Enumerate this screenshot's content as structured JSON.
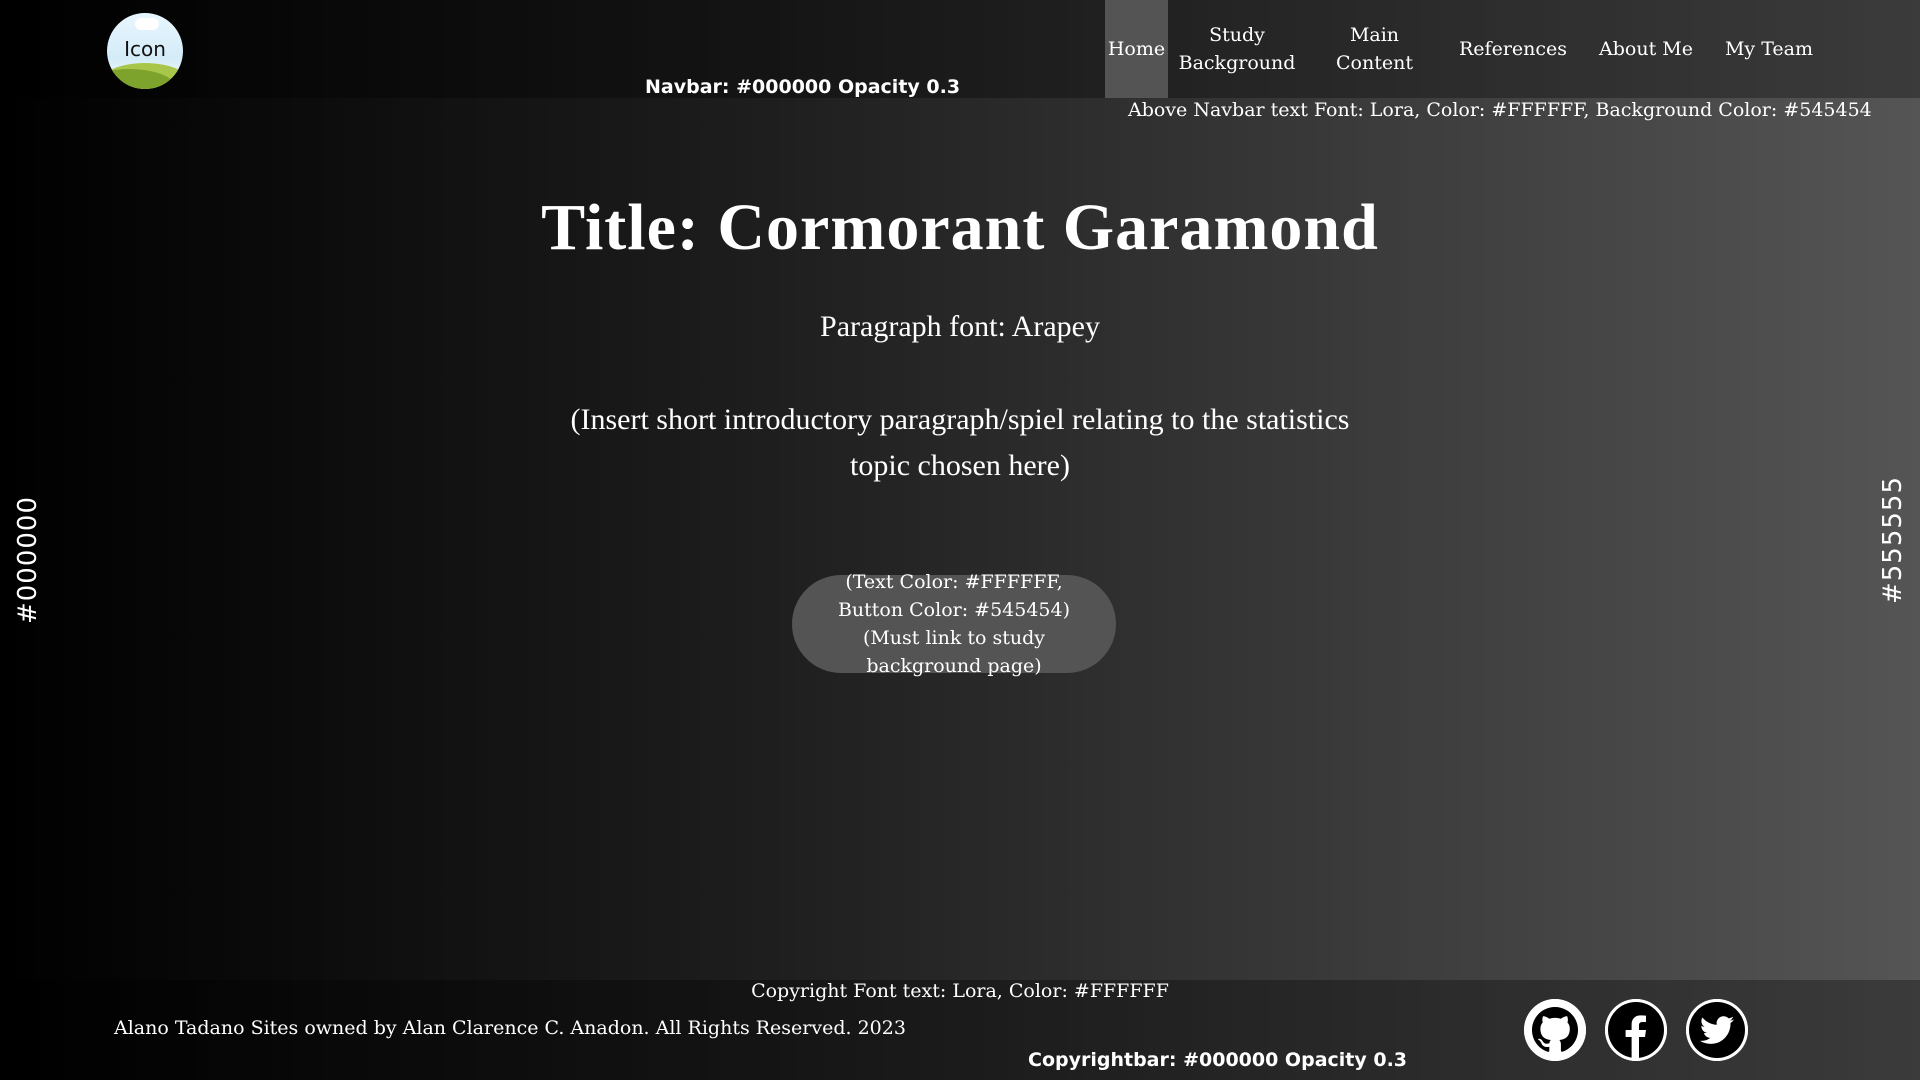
{
  "navbar": {
    "logo_text": "Icon",
    "note": "Navbar: #000000 Opacity 0.3",
    "items": [
      {
        "label": "Home",
        "active": true
      },
      {
        "label": "Study Background",
        "active": false
      },
      {
        "label": "Main Content",
        "active": false
      },
      {
        "label": "References",
        "active": false
      },
      {
        "label": "About Me",
        "active": false
      },
      {
        "label": "My Team",
        "active": false
      }
    ],
    "above_note": "Above Navbar text Font: Lora, Color: #FFFFFF, Background Color: #545454"
  },
  "hero": {
    "title": "Title: Cormorant Garamond",
    "paragraph_font_note": "Paragraph font: Arapey",
    "intro": "(Insert short introductory paragraph/spiel relating to the statistics topic chosen here)",
    "button_label": "(Text Color: #FFFFFF, Button Color: #545454) (Must link to study background page)"
  },
  "side_labels": {
    "left": "#000000",
    "right": "#555555"
  },
  "footer": {
    "font_note": "Copyright Font text: Lora, Color: #FFFFFF",
    "copyright": "Alano Tadano Sites owned by Alan Clarence C. Anadon. All Rights Reserved. 2023",
    "bar_note": "Copyrightbar: #000000 Opacity 0.3",
    "social": [
      {
        "icon": "github-icon"
      },
      {
        "icon": "facebook-icon"
      },
      {
        "icon": "twitter-icon"
      }
    ]
  },
  "colors": {
    "gradient_start": "#000000",
    "gradient_end": "#555555",
    "accent": "#545454",
    "text": "#FFFFFF"
  }
}
